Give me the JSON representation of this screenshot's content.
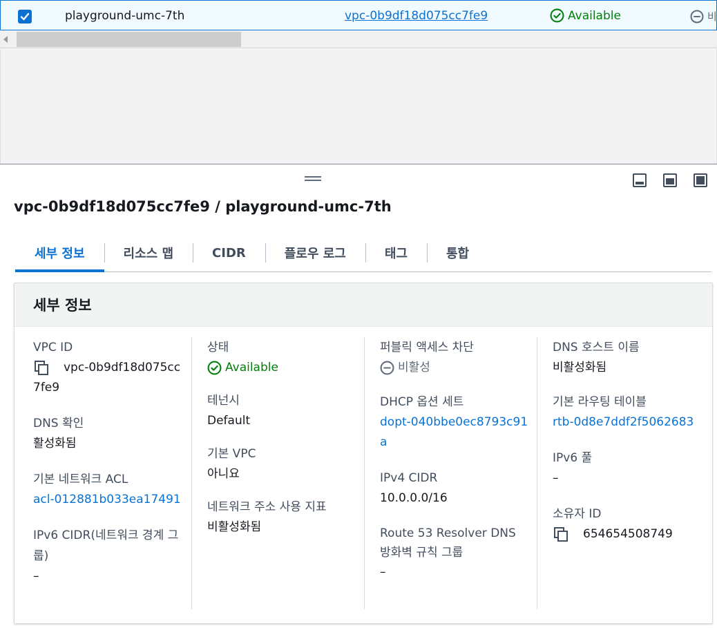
{
  "table_row": {
    "name": "playground-umc-7th",
    "vpc_id": "vpc-0b9df18d075cc7fe9",
    "status": "Available",
    "next_col_partial": "비"
  },
  "panel": {
    "title": "vpc-0b9df18d075cc7fe9 / playground-umc-7th",
    "tabs": [
      "세부 정보",
      "리소스 맵",
      "CIDR",
      "플로우 로그",
      "태그",
      "통합"
    ]
  },
  "details": {
    "header": "세부 정보",
    "col1": {
      "vpc_id_label": "VPC ID",
      "vpc_id_value": "vpc-0b9df18d075cc7fe9",
      "dns_resolution_label": "DNS 확인",
      "dns_resolution_value": "활성화됨",
      "network_acl_label": "기본 네트워크 ACL",
      "network_acl_value": "acl-012881b033ea17491",
      "ipv6_cidr_label": "IPv6 CIDR(네트워크 경계 그룹)",
      "ipv6_cidr_value": "–"
    },
    "col2": {
      "state_label": "상태",
      "state_value": "Available",
      "tenancy_label": "테넌시",
      "tenancy_value": "Default",
      "default_vpc_label": "기본 VPC",
      "default_vpc_value": "아니요",
      "network_usage_label": "네트워크 주소 사용 지표",
      "network_usage_value": "비활성화됨"
    },
    "col3": {
      "block_public_label": "퍼블릭 액세스 차단",
      "block_public_value": "비활성",
      "dhcp_label": "DHCP 옵션 세트",
      "dhcp_value": "dopt-040bbe0ec8793c91a",
      "ipv4_cidr_label": "IPv4 CIDR",
      "ipv4_cidr_value": "10.0.0.0/16",
      "route53_label": "Route 53 Resolver DNS 방화벽 규칙 그룹",
      "route53_value": "–"
    },
    "col4": {
      "dns_hostnames_label": "DNS 호스트 이름",
      "dns_hostnames_value": "비활성화됨",
      "main_route_table_label": "기본 라우팅 테이블",
      "main_route_table_value": "rtb-0d8e7ddf2f5062683",
      "ipv6_pool_label": "IPv6 풀",
      "ipv6_pool_value": "–",
      "owner_id_label": "소유자 ID",
      "owner_id_value": "654654508749"
    }
  },
  "colors": {
    "link": "#0972d3",
    "success": "#037f0c",
    "text": "#16191f",
    "label": "#414d5c"
  },
  "icons": [
    "checkbox-checked-icon",
    "status-available-icon",
    "status-disabled-icon",
    "copy-icon",
    "drag-handle-icon",
    "panel-bottom-icon",
    "panel-side-icon",
    "panel-full-icon"
  ]
}
